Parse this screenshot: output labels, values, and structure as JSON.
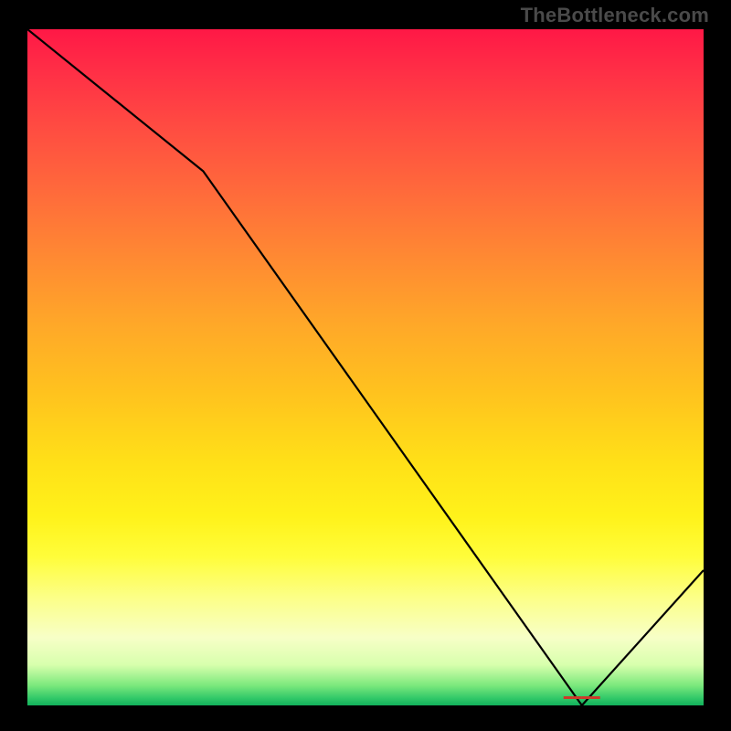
{
  "watermark": "TheBottleneck.com",
  "chart_data": {
    "type": "line",
    "title": "",
    "xlabel": "",
    "ylabel": "",
    "xlim": [
      0,
      100
    ],
    "ylim": [
      0,
      100
    ],
    "x": [
      0,
      26,
      82,
      100
    ],
    "values": [
      100,
      79,
      0,
      20
    ],
    "minimum_marker": {
      "x": 82,
      "label": "▬▬▬▬"
    },
    "gradient_stops": [
      {
        "pct": 0,
        "color": "#ff1846"
      },
      {
        "pct": 50,
        "color": "#ffc31e"
      },
      {
        "pct": 80,
        "color": "#fffd3a"
      },
      {
        "pct": 100,
        "color": "#12b15c"
      }
    ]
  }
}
